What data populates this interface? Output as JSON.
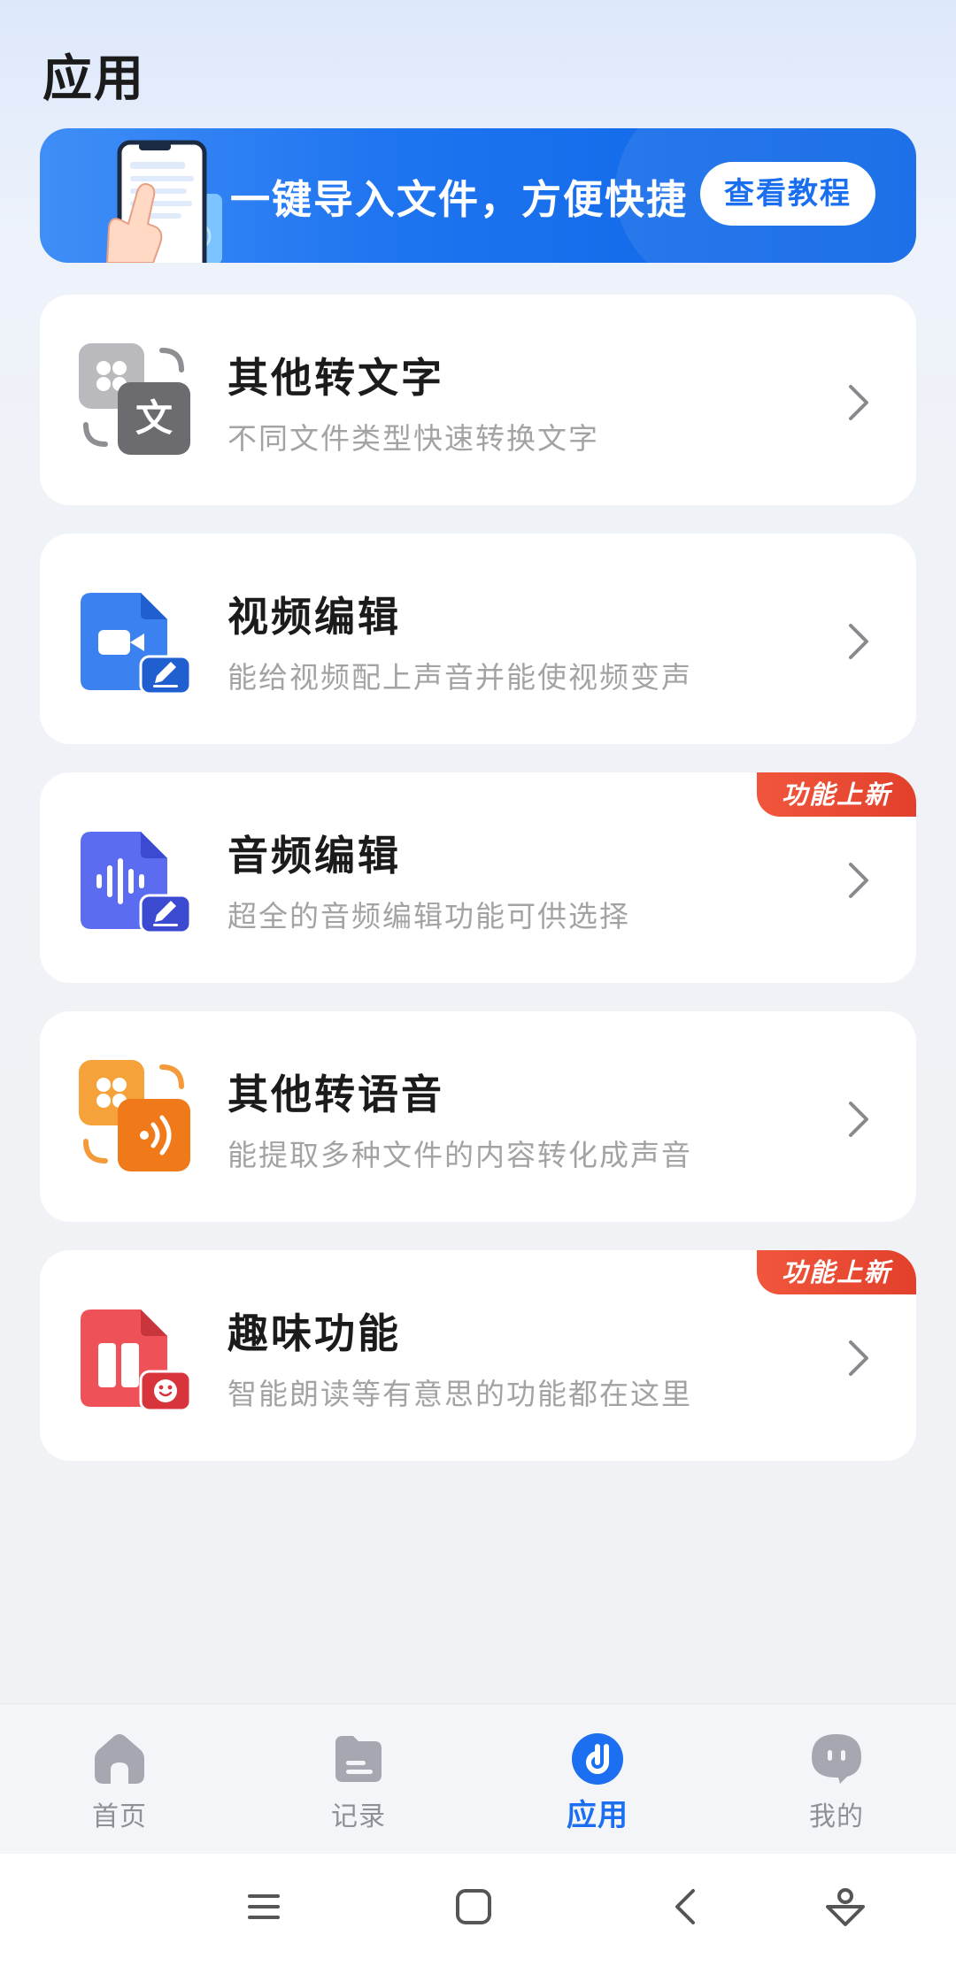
{
  "page": {
    "title": "应用"
  },
  "banner": {
    "text": "一键导入文件，方便快捷",
    "button_label": "查看教程",
    "illustration_icon": "phone-import-illustration",
    "colors": {
      "start": "#3f8ef7",
      "end": "#0b64e6"
    }
  },
  "features": [
    {
      "title": "其他转文字",
      "description": "不同文件类型快速转换文字",
      "icon": "doc-to-text-icon",
      "badge": ""
    },
    {
      "title": "视频编辑",
      "description": "能给视频配上声音并能使视频变声",
      "icon": "video-edit-icon",
      "badge": ""
    },
    {
      "title": "音频编辑",
      "description": "超全的音频编辑功能可供选择",
      "icon": "audio-edit-icon",
      "badge": "功能上新"
    },
    {
      "title": "其他转语音",
      "description": "能提取多种文件的内容转化成声音",
      "icon": "doc-to-voice-icon",
      "badge": ""
    },
    {
      "title": "趣味功能",
      "description": "智能朗读等有意思的功能都在这里",
      "icon": "fun-features-icon",
      "badge": "功能上新"
    }
  ],
  "bottom_nav": {
    "items": [
      {
        "label": "首页",
        "icon": "home-icon",
        "active": false
      },
      {
        "label": "记录",
        "icon": "folder-icon",
        "active": false
      },
      {
        "label": "应用",
        "icon": "apps-icon",
        "active": true
      },
      {
        "label": "我的",
        "icon": "profile-icon",
        "active": false
      }
    ],
    "active_color": "#1b6ff0",
    "inactive_color": "#8e9096"
  },
  "system_nav": {
    "buttons": [
      "menu-icon",
      "home-square-icon",
      "back-icon",
      "assistant-icon"
    ]
  }
}
